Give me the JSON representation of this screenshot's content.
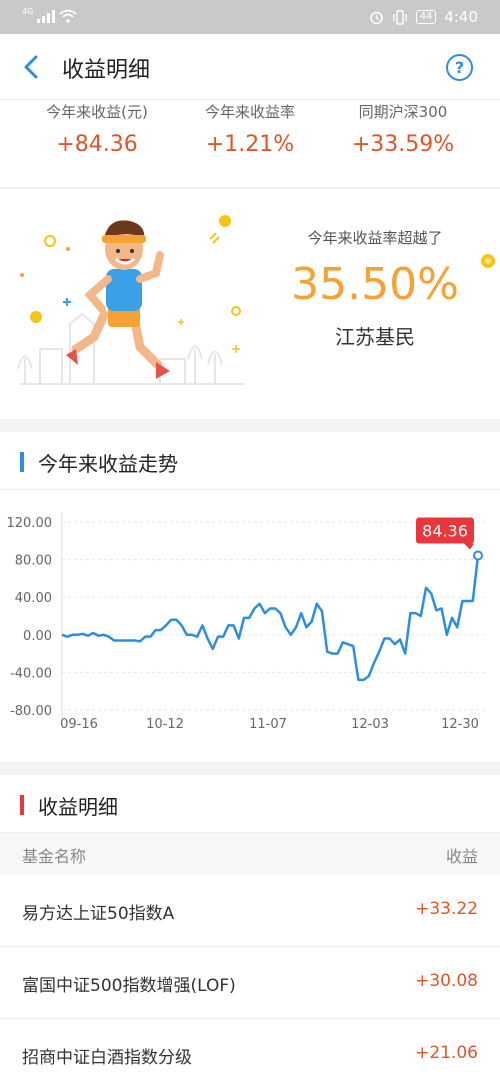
{
  "status": {
    "network": "4G",
    "battery": "44",
    "time": "4:40"
  },
  "nav": {
    "title": "收益明细",
    "help_glyph": "?"
  },
  "summary": [
    {
      "label": "今年来收益(元)",
      "value": "+84.36"
    },
    {
      "label": "今年来收益率",
      "value": "+1.21%"
    },
    {
      "label": "同期沪深300",
      "value": "+33.59%"
    }
  ],
  "hero": {
    "label": "今年来收益率超越了",
    "value": "35.50%",
    "group": "江苏基民"
  },
  "trend": {
    "title": "今年来收益走势",
    "accent": "#2e8de0"
  },
  "chart_data": {
    "type": "line",
    "x_tick_labels": [
      "09-16",
      "10-12",
      "11-07",
      "12-03",
      "12-30"
    ],
    "y_tick_labels": [
      "120.00",
      "80.00",
      "40.00",
      "0.00",
      "-40.00",
      "-80.00"
    ],
    "ylim": [
      -80,
      120
    ],
    "grid": true,
    "callout": "84.36",
    "series": [
      {
        "color": "#2e8de0",
        "values": [
          0,
          -2,
          0,
          0,
          1,
          -1,
          2,
          -1,
          0,
          -2,
          -6,
          -6,
          -6,
          -6,
          -6,
          -7,
          -2,
          -2,
          5,
          5,
          10,
          16,
          16,
          10,
          0,
          0,
          -2,
          10,
          -4,
          -15,
          -2,
          -2,
          10,
          10,
          -4,
          18,
          18,
          28,
          33,
          23,
          28,
          28,
          23,
          8,
          0,
          8,
          23,
          8,
          14,
          33,
          25,
          -18,
          -20,
          -20,
          -8,
          -10,
          -12,
          -48,
          -48,
          -44,
          -30,
          -18,
          -4,
          -4,
          -10,
          -5,
          -20,
          23,
          23,
          20,
          50,
          44,
          26,
          28,
          0,
          18,
          8,
          36,
          36,
          36,
          84.36
        ]
      }
    ]
  },
  "detail": {
    "title": "收益明细",
    "accent": "#e8383d",
    "col_name": "基金名称",
    "col_earn": "收益",
    "rows": [
      {
        "name": "易方达上证50指数A",
        "value": "+33.22"
      },
      {
        "name": "富国中证500指数增强(LOF)",
        "value": "+30.08"
      },
      {
        "name": "招商中证白酒指数分级",
        "value": "+21.06"
      }
    ]
  }
}
